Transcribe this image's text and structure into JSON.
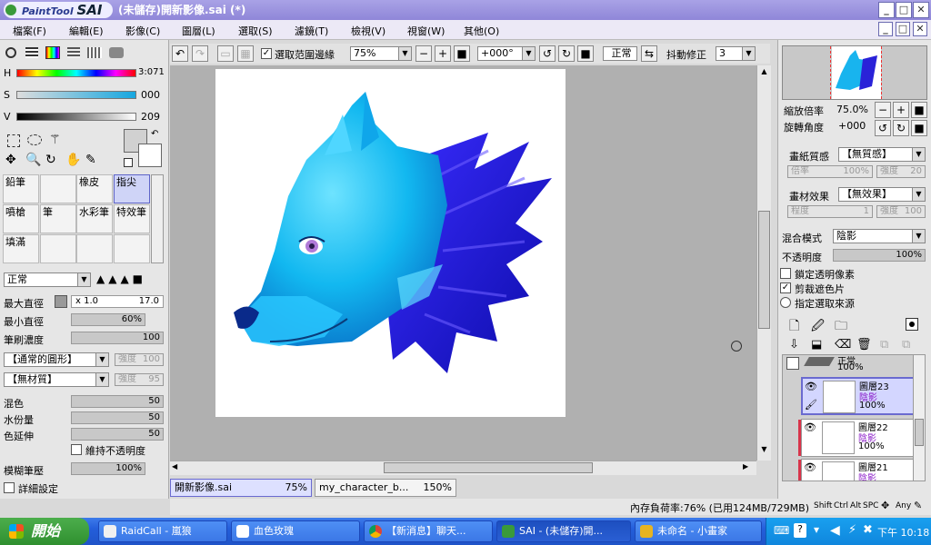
{
  "window": {
    "app_logo_text": "PaintTool",
    "app_logo_brand": "SAI",
    "title": "(未儲存)開新影像.sai (*)"
  },
  "menu": [
    "檔案(F)",
    "編輯(E)",
    "影像(C)",
    "圖層(L)",
    "選取(S)",
    "濾鏡(T)",
    "檢視(V)",
    "視窗(W)",
    "其他(O)"
  ],
  "color": {
    "h_label": "H",
    "h_value": "3:071",
    "s_label": "S",
    "s_value": "000",
    "v_label": "V",
    "v_value": "209"
  },
  "tools": [
    {
      "label": "鉛筆"
    },
    {
      "label": "噴槍"
    },
    {
      "label": "橡皮"
    },
    {
      "label": "指尖"
    },
    {
      "label": "筆"
    },
    {
      "label": "水彩筆"
    },
    {
      "label": "特效筆"
    },
    {
      "label": "填滿"
    }
  ],
  "brush": {
    "blend_mode": "正常",
    "max_size_label": "最大直徑",
    "max_size_mult": "x 1.0",
    "max_size_value": "17.0",
    "min_size_label": "最小直徑",
    "min_size_value": "60%",
    "density_label": "筆刷濃度",
    "density_value": "100",
    "shape": "【通常的圓形】",
    "shape_strength_label": "強度",
    "shape_strength": "100",
    "texture": "【無材質】",
    "texture_strength_label": "強度",
    "texture_strength": "95",
    "mix_label": "混色",
    "mix_value": "50",
    "water_label": "水份量",
    "water_value": "50",
    "stretch_label": "色延伸",
    "stretch_value": "50",
    "keep_opacity": "維持不透明度",
    "blur_label": "模糊筆壓",
    "blur_value": "100%",
    "detail": "詳細設定"
  },
  "toolbar": {
    "selection_edge": "選取范圍邊緣",
    "zoom": "75%",
    "rotation": "+000°",
    "mode": "正常",
    "stabilizer_label": "抖動修正",
    "stabilizer_value": "3"
  },
  "navigator": {
    "zoom_label": "縮放倍率",
    "zoom_value": "75.0%",
    "rotate_label": "旋轉角度",
    "rotate_value": "+000"
  },
  "layer_props": {
    "paper_label": "畫紙質感",
    "paper_value": "【無質感】",
    "paper_scale_label": "倍率",
    "paper_scale": "100%",
    "paper_strength_label": "強度",
    "paper_strength": "20",
    "effect_label": "畫材效果",
    "effect_value": "【無效果】",
    "effect_degree_label": "程度",
    "effect_degree": "1",
    "effect_strength_label": "強度",
    "effect_strength": "100",
    "blend_label": "混合模式",
    "blend_value": "陰影",
    "opacity_label": "不透明度",
    "opacity_value": "100%",
    "lock_alpha": "鎖定透明像素",
    "clip": "剪裁遮色片",
    "selection_source": "指定選取來源"
  },
  "layers": [
    {
      "name": "正常",
      "mode": "",
      "opacity": "100%"
    },
    {
      "name": "圖層23",
      "mode": "陰影",
      "opacity": "100%"
    },
    {
      "name": "圖層22",
      "mode": "陰影",
      "opacity": "100%"
    },
    {
      "name": "圖層21",
      "mode": "陰影",
      "opacity": ""
    }
  ],
  "doc_tabs": [
    {
      "name": "開新影像.sai",
      "zoom": "75%"
    },
    {
      "name": "my_character_b...",
      "zoom": "150%"
    }
  ],
  "status": {
    "memory": "內存負荷率:76% (已用124MB/729MB)",
    "keys": [
      "Shift",
      "Ctrl",
      "Alt",
      "SPC",
      "Any"
    ]
  },
  "taskbar": {
    "start": "開始",
    "tasks": [
      {
        "label": "RaidCall - 嵐狼",
        "color": "#f0f0f0"
      },
      {
        "label": "血色玫瑰",
        "color": "#ffffff"
      },
      {
        "label": "【新消息】聊天...",
        "color": "#e74c3c"
      },
      {
        "label": "SAI - (未儲存)開...",
        "color": "#3a9a3a"
      },
      {
        "label": "未命名 - 小畫家",
        "color": "#e6b422"
      }
    ],
    "clock": "下午 10:18"
  }
}
